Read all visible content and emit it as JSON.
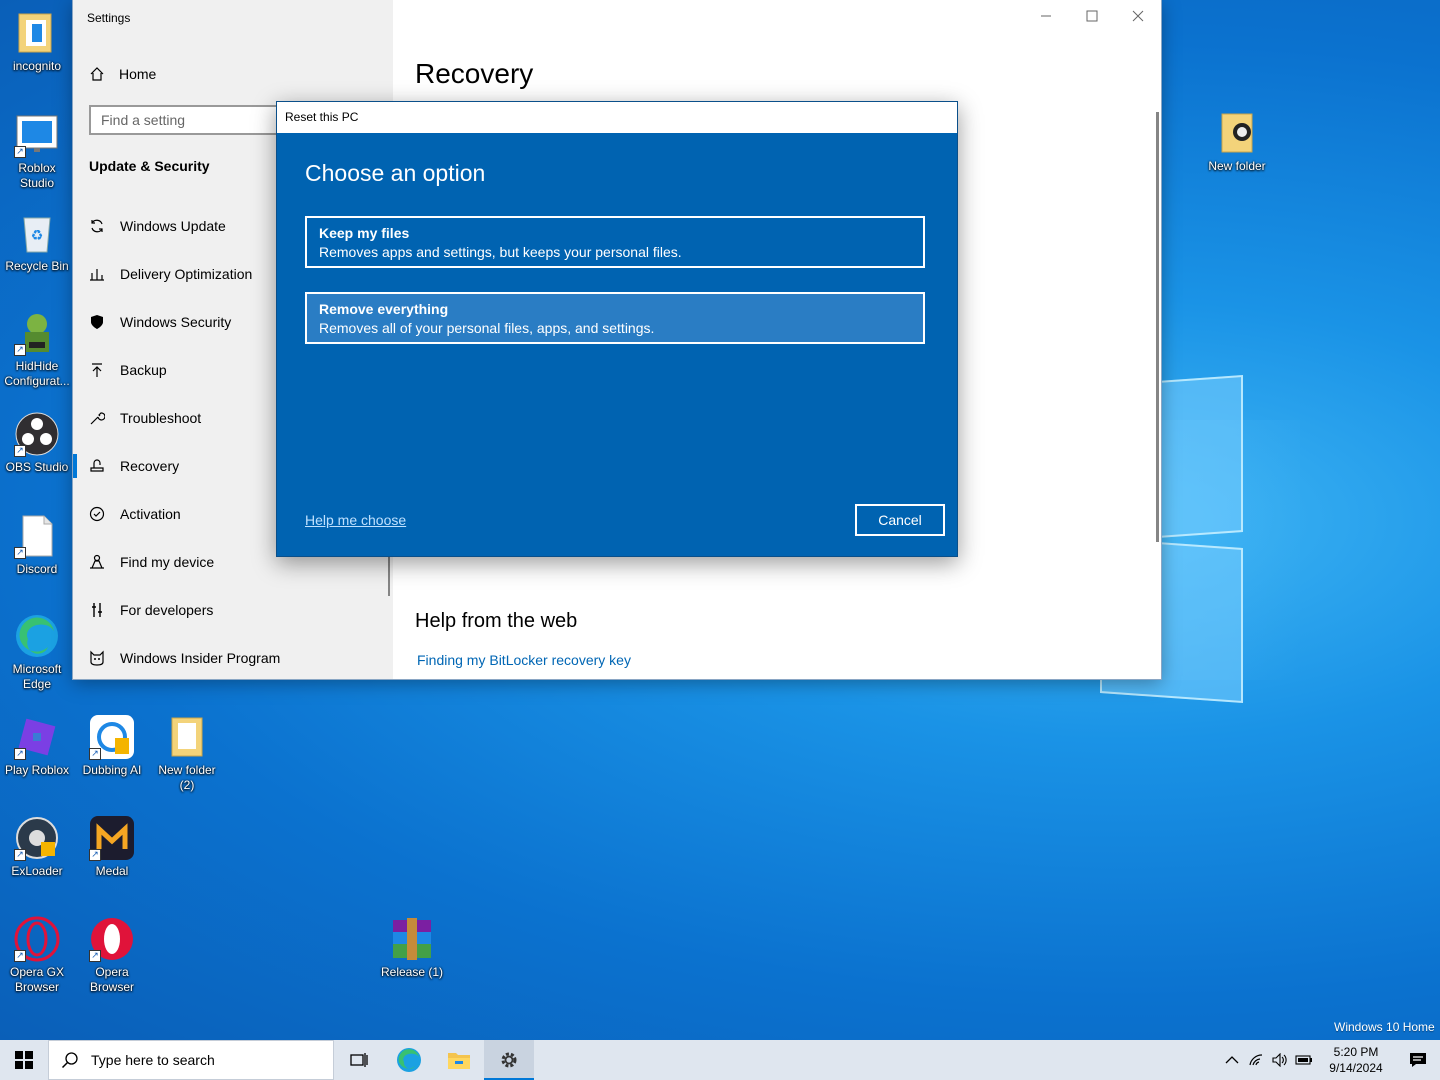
{
  "desktop": {
    "icons": [
      {
        "label": "incognito"
      },
      {
        "label": "Roblox Studio"
      },
      {
        "label": "Recycle Bin"
      },
      {
        "label": "HidHide Configurat..."
      },
      {
        "label": "OBS Studio"
      },
      {
        "label": "Discord"
      },
      {
        "label": "Microsoft Edge"
      },
      {
        "label": "Play Roblox"
      },
      {
        "label": "Dubbing AI"
      },
      {
        "label": "New folder (2)"
      },
      {
        "label": "ExLoader"
      },
      {
        "label": "Medal"
      },
      {
        "label": "Opera GX Browser"
      },
      {
        "label": "Opera Browser"
      },
      {
        "label": "Release (1)"
      },
      {
        "label": "New folder"
      }
    ],
    "edition_watermark": "Windows 10 Home"
  },
  "settings": {
    "window_title": "Settings",
    "home_label": "Home",
    "search_placeholder": "Find a setting",
    "section_title": "Update & Security",
    "nav_items": [
      {
        "label": "Windows Update",
        "icon": "refresh-icon"
      },
      {
        "label": "Delivery Optimization",
        "icon": "delivery-optimization-icon"
      },
      {
        "label": "Windows Security",
        "icon": "shield-icon"
      },
      {
        "label": "Backup",
        "icon": "backup-arrow-icon"
      },
      {
        "label": "Troubleshoot",
        "icon": "wrench-icon"
      },
      {
        "label": "Recovery",
        "icon": "recovery-icon",
        "active": true
      },
      {
        "label": "Activation",
        "icon": "check-circle-icon"
      },
      {
        "label": "Find my device",
        "icon": "person-locate-icon"
      },
      {
        "label": "For developers",
        "icon": "developer-tools-icon"
      },
      {
        "label": "Windows Insider Program",
        "icon": "insider-cat-icon"
      }
    ],
    "page_title": "Recovery",
    "help_title": "Help from the web",
    "help_link": "Finding my BitLocker recovery key"
  },
  "dialog": {
    "title": "Reset this PC",
    "heading": "Choose an option",
    "options": [
      {
        "title": "Keep my files",
        "desc": "Removes apps and settings, but keeps your personal files."
      },
      {
        "title": "Remove everything",
        "desc": "Removes all of your personal files, apps, and settings."
      }
    ],
    "help_link": "Help me choose",
    "cancel_label": "Cancel",
    "accent_color": "#0063b1"
  },
  "taskbar": {
    "search_placeholder": "Type here to search",
    "time": "5:20 PM",
    "date": "9/14/2024"
  }
}
